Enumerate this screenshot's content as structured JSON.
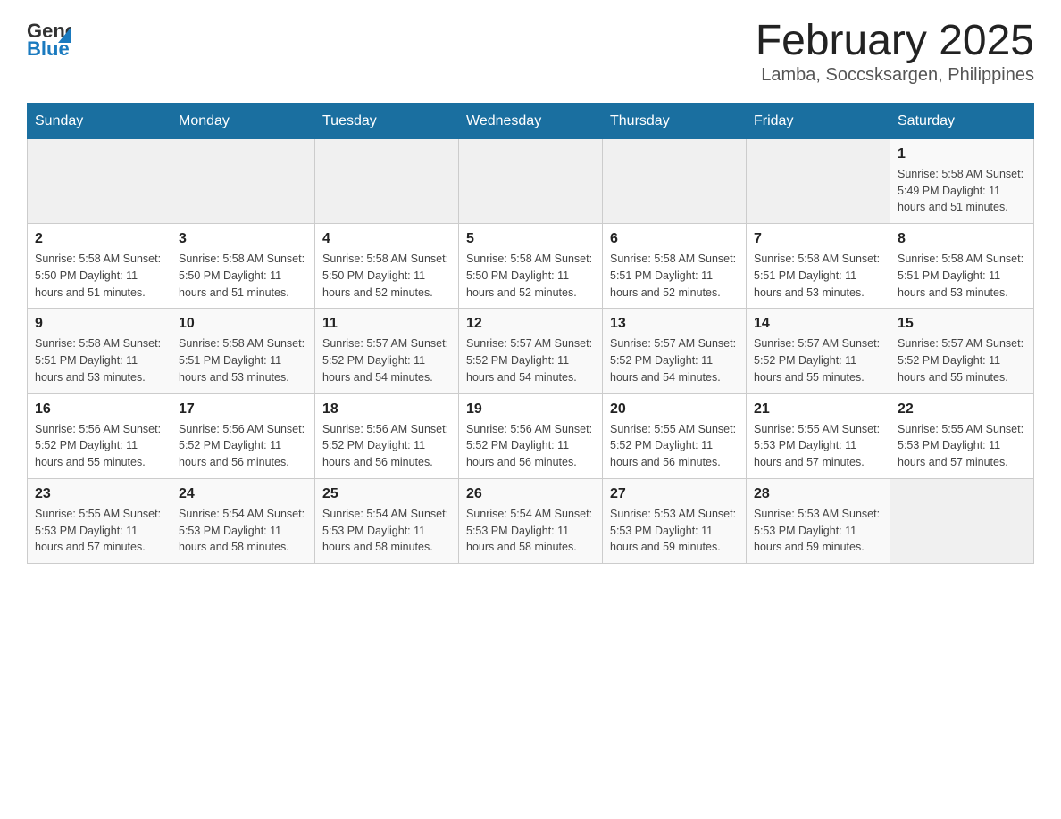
{
  "header": {
    "logo_general": "General",
    "logo_blue": "Blue",
    "month_title": "February 2025",
    "location": "Lamba, Soccsksargen, Philippines"
  },
  "days_of_week": [
    "Sunday",
    "Monday",
    "Tuesday",
    "Wednesday",
    "Thursday",
    "Friday",
    "Saturday"
  ],
  "weeks": [
    {
      "days": [
        {
          "number": "",
          "info": ""
        },
        {
          "number": "",
          "info": ""
        },
        {
          "number": "",
          "info": ""
        },
        {
          "number": "",
          "info": ""
        },
        {
          "number": "",
          "info": ""
        },
        {
          "number": "",
          "info": ""
        },
        {
          "number": "1",
          "info": "Sunrise: 5:58 AM\nSunset: 5:49 PM\nDaylight: 11 hours and 51 minutes."
        }
      ]
    },
    {
      "days": [
        {
          "number": "2",
          "info": "Sunrise: 5:58 AM\nSunset: 5:50 PM\nDaylight: 11 hours and 51 minutes."
        },
        {
          "number": "3",
          "info": "Sunrise: 5:58 AM\nSunset: 5:50 PM\nDaylight: 11 hours and 51 minutes."
        },
        {
          "number": "4",
          "info": "Sunrise: 5:58 AM\nSunset: 5:50 PM\nDaylight: 11 hours and 52 minutes."
        },
        {
          "number": "5",
          "info": "Sunrise: 5:58 AM\nSunset: 5:50 PM\nDaylight: 11 hours and 52 minutes."
        },
        {
          "number": "6",
          "info": "Sunrise: 5:58 AM\nSunset: 5:51 PM\nDaylight: 11 hours and 52 minutes."
        },
        {
          "number": "7",
          "info": "Sunrise: 5:58 AM\nSunset: 5:51 PM\nDaylight: 11 hours and 53 minutes."
        },
        {
          "number": "8",
          "info": "Sunrise: 5:58 AM\nSunset: 5:51 PM\nDaylight: 11 hours and 53 minutes."
        }
      ]
    },
    {
      "days": [
        {
          "number": "9",
          "info": "Sunrise: 5:58 AM\nSunset: 5:51 PM\nDaylight: 11 hours and 53 minutes."
        },
        {
          "number": "10",
          "info": "Sunrise: 5:58 AM\nSunset: 5:51 PM\nDaylight: 11 hours and 53 minutes."
        },
        {
          "number": "11",
          "info": "Sunrise: 5:57 AM\nSunset: 5:52 PM\nDaylight: 11 hours and 54 minutes."
        },
        {
          "number": "12",
          "info": "Sunrise: 5:57 AM\nSunset: 5:52 PM\nDaylight: 11 hours and 54 minutes."
        },
        {
          "number": "13",
          "info": "Sunrise: 5:57 AM\nSunset: 5:52 PM\nDaylight: 11 hours and 54 minutes."
        },
        {
          "number": "14",
          "info": "Sunrise: 5:57 AM\nSunset: 5:52 PM\nDaylight: 11 hours and 55 minutes."
        },
        {
          "number": "15",
          "info": "Sunrise: 5:57 AM\nSunset: 5:52 PM\nDaylight: 11 hours and 55 minutes."
        }
      ]
    },
    {
      "days": [
        {
          "number": "16",
          "info": "Sunrise: 5:56 AM\nSunset: 5:52 PM\nDaylight: 11 hours and 55 minutes."
        },
        {
          "number": "17",
          "info": "Sunrise: 5:56 AM\nSunset: 5:52 PM\nDaylight: 11 hours and 56 minutes."
        },
        {
          "number": "18",
          "info": "Sunrise: 5:56 AM\nSunset: 5:52 PM\nDaylight: 11 hours and 56 minutes."
        },
        {
          "number": "19",
          "info": "Sunrise: 5:56 AM\nSunset: 5:52 PM\nDaylight: 11 hours and 56 minutes."
        },
        {
          "number": "20",
          "info": "Sunrise: 5:55 AM\nSunset: 5:52 PM\nDaylight: 11 hours and 56 minutes."
        },
        {
          "number": "21",
          "info": "Sunrise: 5:55 AM\nSunset: 5:53 PM\nDaylight: 11 hours and 57 minutes."
        },
        {
          "number": "22",
          "info": "Sunrise: 5:55 AM\nSunset: 5:53 PM\nDaylight: 11 hours and 57 minutes."
        }
      ]
    },
    {
      "days": [
        {
          "number": "23",
          "info": "Sunrise: 5:55 AM\nSunset: 5:53 PM\nDaylight: 11 hours and 57 minutes."
        },
        {
          "number": "24",
          "info": "Sunrise: 5:54 AM\nSunset: 5:53 PM\nDaylight: 11 hours and 58 minutes."
        },
        {
          "number": "25",
          "info": "Sunrise: 5:54 AM\nSunset: 5:53 PM\nDaylight: 11 hours and 58 minutes."
        },
        {
          "number": "26",
          "info": "Sunrise: 5:54 AM\nSunset: 5:53 PM\nDaylight: 11 hours and 58 minutes."
        },
        {
          "number": "27",
          "info": "Sunrise: 5:53 AM\nSunset: 5:53 PM\nDaylight: 11 hours and 59 minutes."
        },
        {
          "number": "28",
          "info": "Sunrise: 5:53 AM\nSunset: 5:53 PM\nDaylight: 11 hours and 59 minutes."
        },
        {
          "number": "",
          "info": ""
        }
      ]
    }
  ]
}
